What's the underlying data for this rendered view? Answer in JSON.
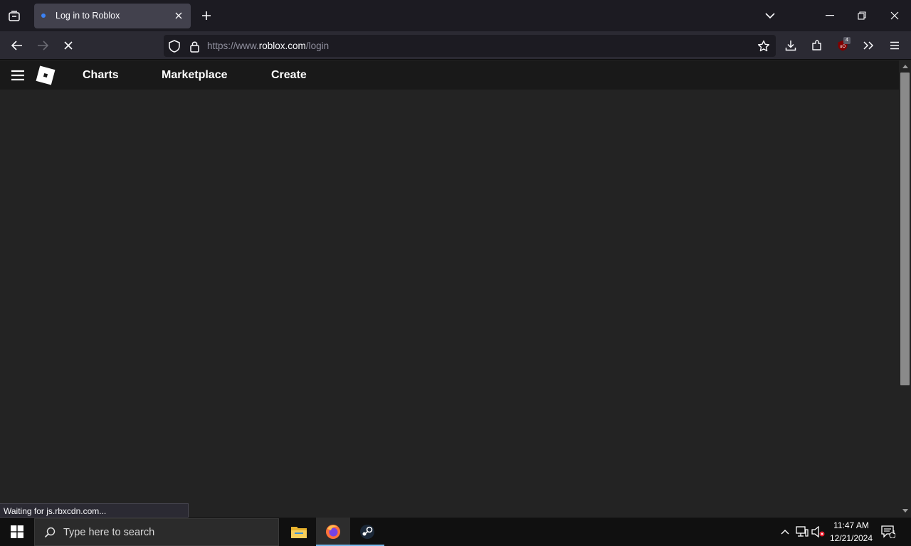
{
  "browser": {
    "tab": {
      "title": "Log in to Roblox"
    },
    "url": {
      "scheme": "https://www.",
      "host": "roblox.com",
      "path": "/login"
    },
    "extension_badge": "4",
    "status_text": "Waiting for js.rbxcdn.com..."
  },
  "roblox": {
    "nav": [
      "Charts",
      "Marketplace",
      "Create"
    ]
  },
  "taskbar": {
    "search_placeholder": "Type here to search",
    "time": "11:47 AM",
    "date": "12/21/2024",
    "notification_count": "1"
  },
  "colors": {
    "page_background": "#232323",
    "header_background": "#191919",
    "browser_chrome": "#2b2a33",
    "tab_active": "#42414d"
  }
}
